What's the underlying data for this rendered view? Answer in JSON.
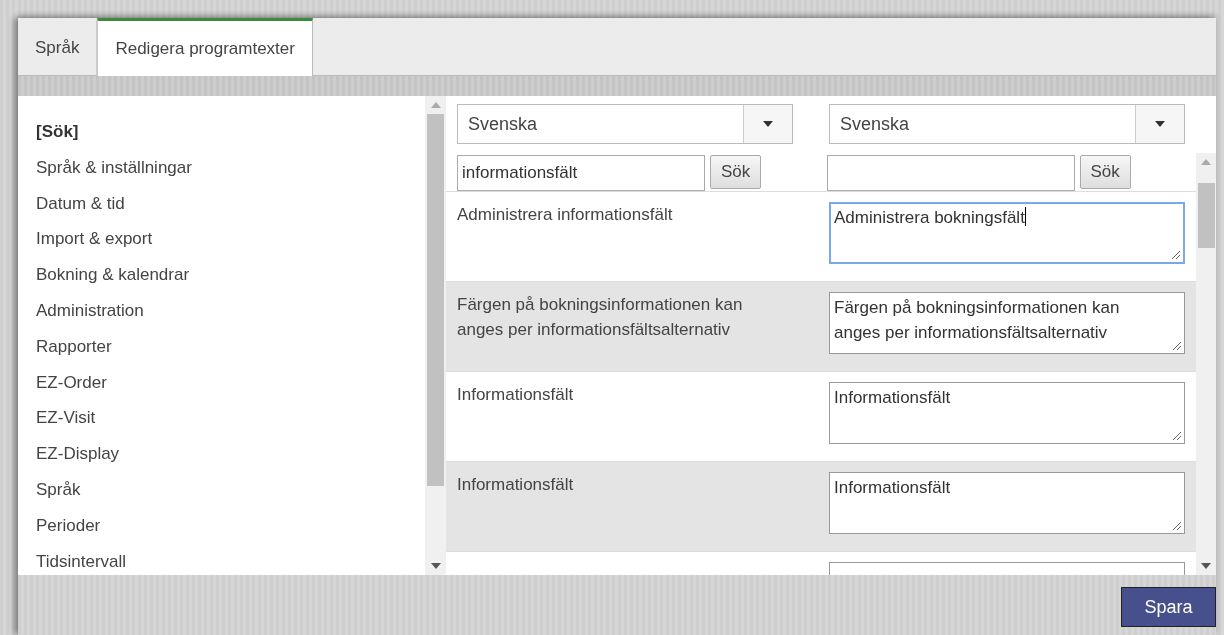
{
  "tabs": [
    {
      "label": "Språk",
      "selected": false
    },
    {
      "label": "Redigera programtexter",
      "selected": true
    }
  ],
  "sidebar": {
    "items": [
      {
        "label": "[Sök]",
        "selected": true
      },
      {
        "label": "Språk & inställningar",
        "selected": false
      },
      {
        "label": "Datum & tid",
        "selected": false
      },
      {
        "label": "Import & export",
        "selected": false
      },
      {
        "label": "Bokning & kalendrar",
        "selected": false
      },
      {
        "label": "Administration",
        "selected": false
      },
      {
        "label": "Rapporter",
        "selected": false
      },
      {
        "label": "EZ-Order",
        "selected": false
      },
      {
        "label": "EZ-Visit",
        "selected": false
      },
      {
        "label": "EZ-Display",
        "selected": false
      },
      {
        "label": "Språk",
        "selected": false
      },
      {
        "label": "Perioder",
        "selected": false
      },
      {
        "label": "Tidsintervall",
        "selected": false
      }
    ]
  },
  "source": {
    "language": "Svenska",
    "search_value": "informationsfält",
    "search_button": "Sök"
  },
  "target": {
    "language": "Svenska",
    "search_button": "Sök"
  },
  "rows": [
    {
      "source": "Administrera informationsfält",
      "translation": "Administrera bokningsfält",
      "focused": true
    },
    {
      "source": "Färgen på bokningsinformationen kan anges per informationsfältsalternativ",
      "translation": "Färgen på bokningsinformationen kan anges per informationsfältsalternativ",
      "focused": false
    },
    {
      "source": "Informationsfält",
      "translation": "Informationsfält",
      "focused": false
    },
    {
      "source": "Informationsfält",
      "translation": "Informationsfält",
      "focused": false
    }
  ],
  "save_button": "Spara"
}
